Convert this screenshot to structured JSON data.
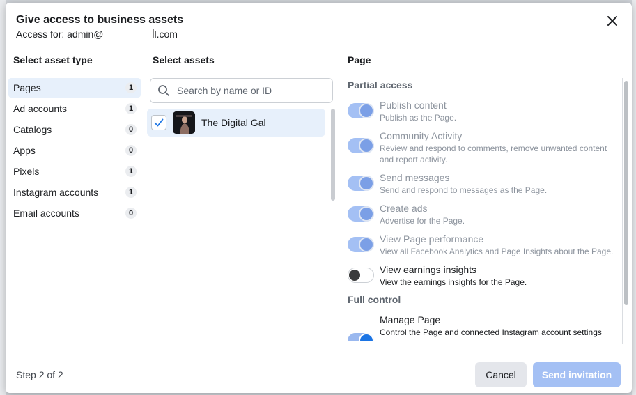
{
  "dialog": {
    "title": "Give access to business assets",
    "subtitle_prefix": "Access for: admin@",
    "subtitle_suffix": "l.com",
    "close_icon": "close-icon"
  },
  "columns": {
    "asset_type": "Select asset type",
    "assets": "Select assets",
    "permissions": "Page"
  },
  "asset_types": [
    {
      "label": "Pages",
      "count": "1",
      "selected": true
    },
    {
      "label": "Ad accounts",
      "count": "1"
    },
    {
      "label": "Catalogs",
      "count": "0"
    },
    {
      "label": "Apps",
      "count": "0"
    },
    {
      "label": "Pixels",
      "count": "1"
    },
    {
      "label": "Instagram accounts",
      "count": "1"
    },
    {
      "label": "Email accounts",
      "count": "0"
    }
  ],
  "search": {
    "placeholder": "Search by name or ID",
    "value": "",
    "icon": "search-icon"
  },
  "assets": [
    {
      "name": "The Digital Gal",
      "checked": true
    }
  ],
  "permissions": {
    "partial_label": "Partial access",
    "full_label": "Full control",
    "partial": [
      {
        "title": "Publish content",
        "desc": "Publish as the Page.",
        "state": "on-disabled"
      },
      {
        "title": "Community Activity",
        "desc": "Review and respond to comments, remove unwanted content and report activity.",
        "state": "on-disabled"
      },
      {
        "title": "Send messages",
        "desc": "Send and respond to messages as the Page.",
        "state": "on-disabled"
      },
      {
        "title": "Create ads",
        "desc": "Advertise for the Page.",
        "state": "on-disabled"
      },
      {
        "title": "View Page performance",
        "desc": "View all Facebook Analytics and Page Insights about the Page.",
        "state": "on-disabled"
      },
      {
        "title": "View earnings insights",
        "desc": "View the earnings insights for the Page.",
        "state": "off"
      }
    ],
    "full": [
      {
        "title": "Manage Page",
        "desc": "Control the Page and connected Instagram account settings",
        "state": "on"
      }
    ]
  },
  "footer": {
    "step": "Step 2 of 2",
    "cancel": "Cancel",
    "send": "Send invitation"
  },
  "colors": {
    "accent": "#1b74e4",
    "accent_disabled": "#a4c0f4",
    "selected_bg": "#e7f0fb"
  }
}
